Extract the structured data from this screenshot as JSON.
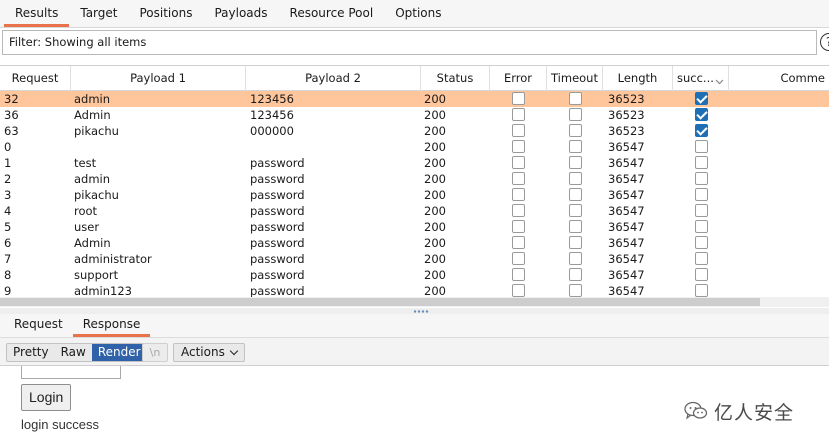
{
  "top_tabs": [
    {
      "label": "Results",
      "active": true
    },
    {
      "label": "Target",
      "active": false
    },
    {
      "label": "Positions",
      "active": false
    },
    {
      "label": "Payloads",
      "active": false
    },
    {
      "label": "Resource Pool",
      "active": false
    },
    {
      "label": "Options",
      "active": false
    }
  ],
  "filter": {
    "text": "Filter: Showing all items",
    "help_icon": "?"
  },
  "table": {
    "headers": [
      "Request",
      "Payload 1",
      "Payload 2",
      "Status",
      "Error",
      "Timeout",
      "Length",
      "succ...",
      "Comme"
    ],
    "rows": [
      {
        "request": "32",
        "payload1": "admin",
        "payload2": "123456",
        "status": "200",
        "error": false,
        "timeout": false,
        "length": "36523",
        "success": true,
        "selected": true
      },
      {
        "request": "36",
        "payload1": "Admin",
        "payload2": "123456",
        "status": "200",
        "error": false,
        "timeout": false,
        "length": "36523",
        "success": true,
        "selected": false
      },
      {
        "request": "63",
        "payload1": "pikachu",
        "payload2": "000000",
        "status": "200",
        "error": false,
        "timeout": false,
        "length": "36523",
        "success": true,
        "selected": false
      },
      {
        "request": "0",
        "payload1": "",
        "payload2": "",
        "status": "200",
        "error": false,
        "timeout": false,
        "length": "36547",
        "success": false,
        "selected": false
      },
      {
        "request": "1",
        "payload1": "test",
        "payload2": "password",
        "status": "200",
        "error": false,
        "timeout": false,
        "length": "36547",
        "success": false,
        "selected": false
      },
      {
        "request": "2",
        "payload1": "admin",
        "payload2": "password",
        "status": "200",
        "error": false,
        "timeout": false,
        "length": "36547",
        "success": false,
        "selected": false
      },
      {
        "request": "3",
        "payload1": "pikachu",
        "payload2": "password",
        "status": "200",
        "error": false,
        "timeout": false,
        "length": "36547",
        "success": false,
        "selected": false
      },
      {
        "request": "4",
        "payload1": "root",
        "payload2": "password",
        "status": "200",
        "error": false,
        "timeout": false,
        "length": "36547",
        "success": false,
        "selected": false
      },
      {
        "request": "5",
        "payload1": "user",
        "payload2": "password",
        "status": "200",
        "error": false,
        "timeout": false,
        "length": "36547",
        "success": false,
        "selected": false
      },
      {
        "request": "6",
        "payload1": "Admin",
        "payload2": "password",
        "status": "200",
        "error": false,
        "timeout": false,
        "length": "36547",
        "success": false,
        "selected": false
      },
      {
        "request": "7",
        "payload1": "administrator",
        "payload2": "password",
        "status": "200",
        "error": false,
        "timeout": false,
        "length": "36547",
        "success": false,
        "selected": false
      },
      {
        "request": "8",
        "payload1": "support",
        "payload2": "password",
        "status": "200",
        "error": false,
        "timeout": false,
        "length": "36547",
        "success": false,
        "selected": false
      },
      {
        "request": "9",
        "payload1": "admin123",
        "payload2": "password",
        "status": "200",
        "error": false,
        "timeout": false,
        "length": "36547",
        "success": false,
        "selected": false
      }
    ]
  },
  "bottom_tabs": [
    {
      "label": "Request",
      "active": false
    },
    {
      "label": "Response",
      "active": true
    }
  ],
  "toolbar": {
    "view_modes": [
      {
        "label": "Pretty",
        "active": false
      },
      {
        "label": "Raw",
        "active": false
      },
      {
        "label": "Render",
        "active": true
      }
    ],
    "newline_label": "\\n",
    "actions_label": "Actions"
  },
  "render": {
    "login_button": "Login",
    "message": "login success"
  },
  "watermark": {
    "text": "亿人安全",
    "icon": "wechat-icon"
  },
  "colors": {
    "selected_row": "#ffc59b",
    "active_tab_underline": "#e8734a",
    "checkbox_checked": "#1f6fb5",
    "active_view_mode": "#2f62a8"
  }
}
